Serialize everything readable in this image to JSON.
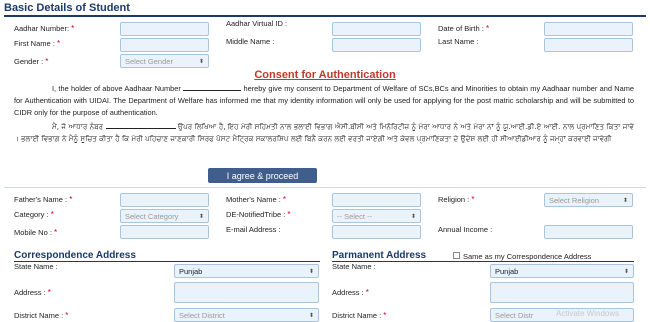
{
  "sections": {
    "basic": "Basic Details of Student",
    "consent_title": "Consent for Authentication",
    "correspondence": "Correspondence Address",
    "permanent": "Parmanent Address"
  },
  "labels": {
    "aadhar_number": "Aadhar Number:",
    "aadhar_virtual_id": "Aadhar Virtual ID :",
    "dob": "Date of Birth :",
    "first_name": "First Name :",
    "middle_name": "Middle Name :",
    "last_name": "Last Name :",
    "gender": "Gender :",
    "fathers_name": "Father's Name :",
    "mothers_name": "Mother's Name :",
    "religion": "Religion :",
    "category": "Category :",
    "de_notified": "DE-NotifiedTribe :",
    "mobile": "Mobile No :",
    "email": "E-mail Address :",
    "annual_income": "Annual Income :",
    "state_name": "State Name :",
    "state_name_2": "State Name :",
    "address": "Address :",
    "address_2": "Address :",
    "district_1": "District Name :",
    "district_2": "District Name :",
    "same_as": "Same as my Correspondence Address"
  },
  "required_mark": "*",
  "selects": {
    "gender": "Select Gender",
    "category": "Select Category",
    "de_notified": "-- Select --",
    "religion": "Select Religion",
    "state_corr": "Punjab",
    "state_perm": "Punjab",
    "district_corr": "Select District",
    "district_perm": "Select Distr"
  },
  "consent": {
    "en_1": "I, the holder of above Aadhaar Number",
    "en_2": "hereby give my consent to Department of Welfare of SCs,BCs and Minorities to obtain my Aadhaar number and Name for Authentication with UIDAI. The Department of Welfare has informed me that my identity information will only be used for applying for the post matric scholarship and will be submitted to CIDR only for the purpose of authentication.",
    "pa_1": "ਮੈਂ, ਜੋ ਆਧਾਰ ਨੰਬਰ",
    "pa_2": "ਉਪਰ ਲਿਖਿਆ ਹੈ, ਇਹ ਮੇਰੀ ਸਹਿਮਤੀ ਨਾਲ ਭਲਾਈ ਵਿਭਾਗ ਐਸੀ.ਬੀਸੀ ਅਤੇ ਮਿਨੋਰਿਟੀਜ਼ ਨੂੰ ਮੇਰਾ ਆਧਾਰ ਨੰ ਅਤੇ ਮੇਰਾ ਨਾਂ ਨੂੰ ਯੂ.ਆਈ.ਡੀ.ਏ ਆਈ. ਨਾਲ ਪ੍ਰਮਾਣਿਤ ਕਿਤਾ ਜਾਵੇ । ਭਲਾਈ ਵਿਭਾਗ ਨੇ ਮੈਨੂੰ ਸੂਚਿਤ ਕੀਤਾ ਹੈ ਕਿ ਮੇਰੀ ਪਹਿਚਾਣ ਜਾਣਕਾਰੀ ਸਿਰਫ ਪੋਸਟ ਮੈਟ੍ਰਿਕ ਸਕਾਲਰਸ਼ਿਪ ਲਈ ਬਿਨੈ ਕਰਨ ਲਈ ਵਰਤੀ ਜਾਏਗੀ ਅਤੇ ਕੇਵਲ ਪ੍ਰਮਾਣਿਕਤਾ ਦੇ ਉਦੇਸ਼ ਲਈ ਹੀ ਸੀਆਈਡੀਆਰ ਨੂੰ ਜਮ੍ਹਾਂ ਕਰਵਾਈ ਜਾਵੇਗੀ"
  },
  "buttons": {
    "agree": "I agree & proceed"
  },
  "watermark": "Activate Windows",
  "colors": {
    "heading": "#1a3a6b",
    "required": "#d0021b",
    "consent_title": "#c0392b",
    "button": "#3f5e8b",
    "input_bg": "#eaf3fb"
  }
}
